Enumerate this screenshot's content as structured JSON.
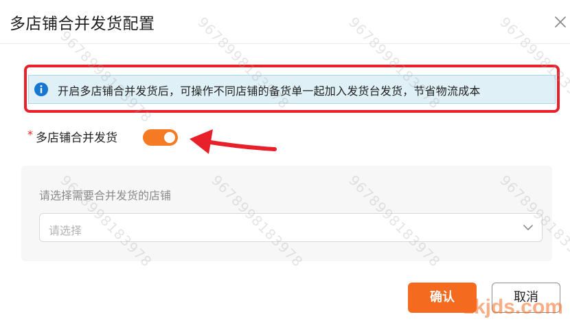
{
  "dialog": {
    "title": "多店铺合并发货配置",
    "close_icon": "close-icon"
  },
  "notice": {
    "icon": "info-icon",
    "text": "开启多店铺合并发货后，可操作不同店铺的备货单一起加入发货台发货，节省物流成本"
  },
  "merge_shipping": {
    "required_mark": "*",
    "label": "多店铺合并发货",
    "enabled": true
  },
  "store_select": {
    "label": "请选择需要合并发货的店铺",
    "placeholder": "请选择",
    "icon": "chevron-down-icon"
  },
  "buttons": {
    "confirm": "确认",
    "cancel": "取消"
  },
  "watermark": {
    "text": "9678998183978",
    "brand": "zkjds.com"
  },
  "colors": {
    "accent": "#f46a1f",
    "annotation": "#e8202a",
    "notice_bg": "#dff0f7",
    "info_blue": "#1677d2"
  }
}
